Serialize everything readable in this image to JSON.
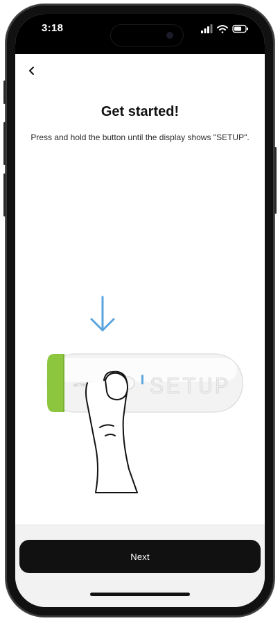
{
  "status_bar": {
    "time": "3:18",
    "signal_icon": "signal-bars-icon",
    "wifi_icon": "wifi-icon",
    "battery_icon": "battery-icon"
  },
  "nav": {
    "back_icon": "chevron-left-icon"
  },
  "content": {
    "title": "Get started!",
    "instruction": "Press and hold the button until the display shows \"SETUP\".",
    "illustration": {
      "arrow_icon": "arrow-down-icon",
      "device_display_text": "SETUP",
      "device_brand_text": "WITHINGS",
      "accent_color": "#8cc63f",
      "arrow_color": "#5aa5de"
    }
  },
  "footer": {
    "next_label": "Next"
  }
}
